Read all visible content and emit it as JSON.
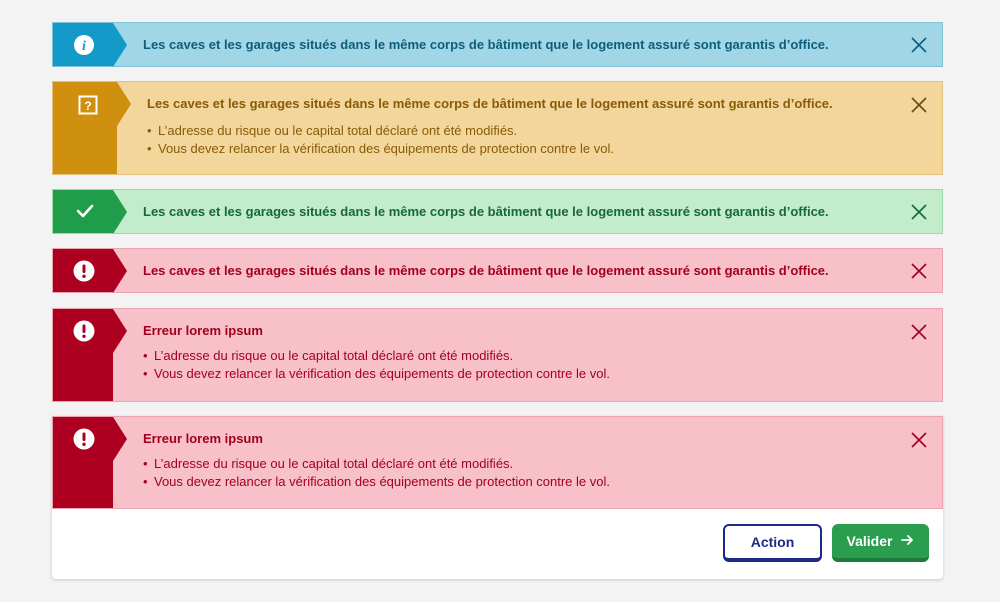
{
  "alerts": [
    {
      "type": "info",
      "icon": "info-icon",
      "title": "Les caves et les garages situés dans le même corps de bâtiment que le logement assuré sont garantis d’office."
    },
    {
      "type": "warning",
      "icon": "question-icon",
      "title": "Les caves et les garages situés dans le même corps de bâtiment que le logement assuré sont garantis d’office.",
      "items": [
        "L’adresse du risque ou le capital total déclaré ont été modifiés.",
        "Vous devez relancer la vérification des équipements de protection contre le vol."
      ]
    },
    {
      "type": "success",
      "icon": "checkmark-icon",
      "title": "Les caves et les garages situés dans le même corps de bâtiment que le logement assuré sont garantis d’office."
    },
    {
      "type": "error",
      "icon": "exclamation-icon",
      "title": "Les caves et les garages situés dans le même corps de bâtiment que le logement assuré sont garantis d’office."
    },
    {
      "type": "error",
      "icon": "exclamation-icon",
      "title": "Erreur lorem ipsum",
      "items": [
        "L’adresse du risque ou le capital total déclaré ont été modifiés.",
        "Vous devez relancer la vérification des équipements de protection contre le vol."
      ]
    }
  ],
  "dialog": {
    "alert": {
      "type": "error",
      "icon": "exclamation-icon",
      "title": "Erreur lorem ipsum",
      "items": [
        "L’adresse du risque ou le capital total déclaré ont été modifiés.",
        "Vous devez relancer la vérification des équipements de protection contre le vol."
      ]
    },
    "action_label": "Action",
    "valider_label": "Valider",
    "valider_icon": "arrow-right-icon"
  },
  "colors": {
    "info": "#139ac9",
    "warning": "#cf8f0f",
    "success": "#1f9d4b",
    "error": "#ad0021",
    "action_border": "#1c2a8a",
    "valider_bg": "#2a9d4e"
  }
}
